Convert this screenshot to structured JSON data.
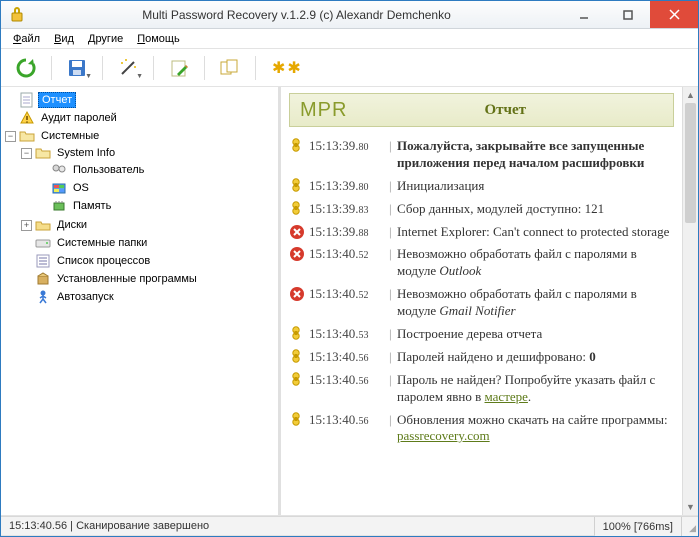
{
  "window": {
    "title": "Multi Password Recovery v.1.2.9 (c) Alexandr Demchenko"
  },
  "menu": {
    "file": "Файл",
    "view": "Вид",
    "other": "Другие",
    "help": "Помощь"
  },
  "toolbar": {
    "refresh": "refresh",
    "save": "save",
    "wand": "wizard",
    "edit": "edit",
    "copy": "copy",
    "asterisks": "✱✱"
  },
  "tree": {
    "root1": "Отчет",
    "root2": "Аудит паролей",
    "root3": "Системные",
    "sysinfo": "System Info",
    "user": "Пользователь",
    "os": "OS",
    "memory": "Память",
    "disks": "Диски",
    "sysfolders": "Системные папки",
    "proclist": "Список процессов",
    "installed": "Установленные программы",
    "autorun": "Автозапуск"
  },
  "report": {
    "logo": "MPR",
    "title": "Отчет",
    "rows": [
      {
        "icon": "info",
        "t": "15:13:39",
        "ms": "80",
        "msg": "Пожалуйста, закрывайте все запущенные приложения перед началом расшифровки",
        "bold": true
      },
      {
        "icon": "info",
        "t": "15:13:39",
        "ms": "80",
        "msg": "Инициализация"
      },
      {
        "icon": "info",
        "t": "15:13:39",
        "ms": "83",
        "msg": "Сбор данных, модулей доступно: 121"
      },
      {
        "icon": "error",
        "t": "15:13:39",
        "ms": "88",
        "msg": "Internet Explorer: Can't connect to protected storage"
      },
      {
        "icon": "error",
        "t": "15:13:40",
        "ms": "52",
        "msg": "Невозможно обработать файл с паролями в модуле <i>Outlook</i>"
      },
      {
        "icon": "error",
        "t": "15:13:40",
        "ms": "52",
        "msg": "Невозможно обработать файл с паролями в модуле <i>Gmail Notifier</i>"
      },
      {
        "icon": "info",
        "t": "15:13:40",
        "ms": "53",
        "msg": "Построение дерева отчета"
      },
      {
        "icon": "info",
        "t": "15:13:40",
        "ms": "56",
        "msg": "Паролей найдено и дешифровано: <b>0</b>"
      },
      {
        "icon": "info",
        "t": "15:13:40",
        "ms": "56",
        "msg": "Пароль не найден? Попробуйте указать файл с паролем явно в <a href='#'>мастере</a>."
      },
      {
        "icon": "info",
        "t": "15:13:40",
        "ms": "56",
        "msg": "Обновления можно скачать на сайте программы: <a href='#'>passrecovery.com</a>"
      }
    ]
  },
  "status": {
    "left": "15:13:40.56 | Сканирование завершено",
    "right": "100% [766ms]"
  }
}
